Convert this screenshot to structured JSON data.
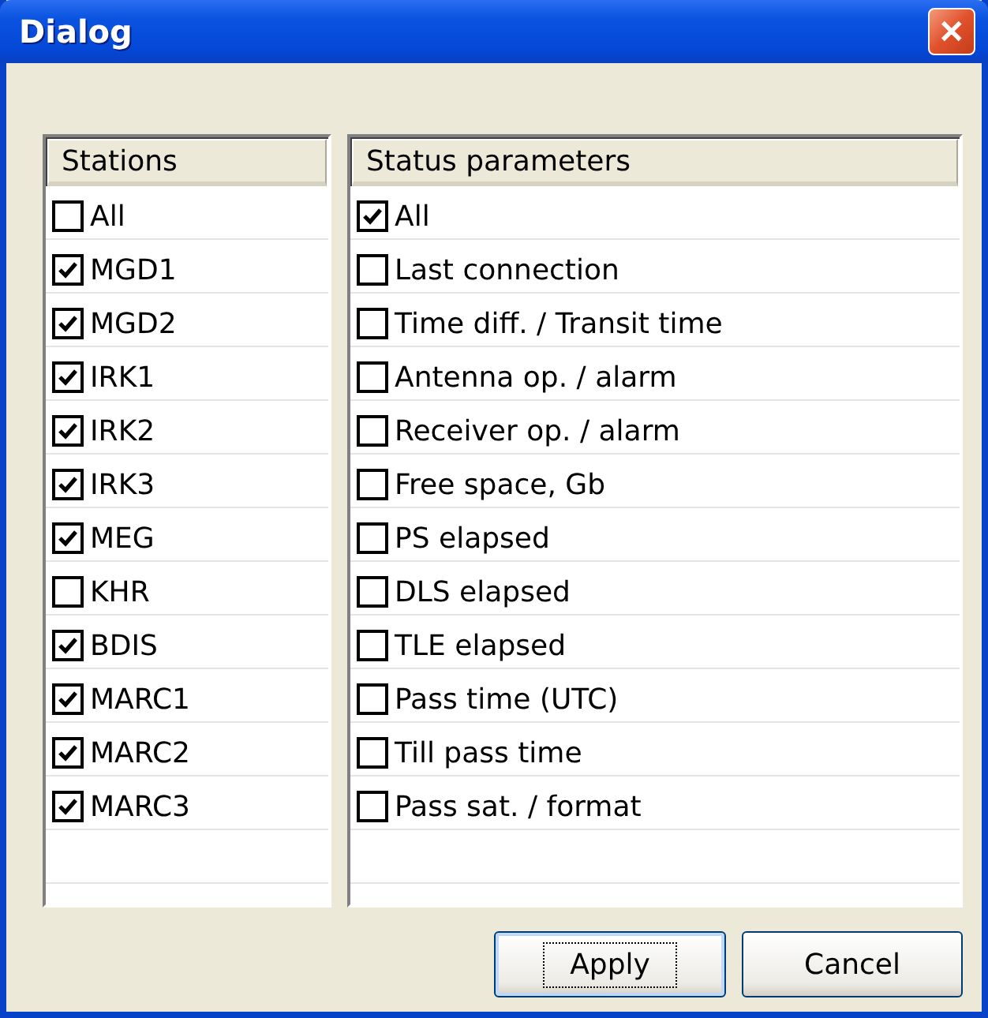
{
  "window": {
    "title": "Dialog",
    "close": "✕"
  },
  "stations": {
    "header": "Stations",
    "items": [
      {
        "label": "All",
        "checked": false
      },
      {
        "label": "MGD1",
        "checked": true
      },
      {
        "label": "MGD2",
        "checked": true
      },
      {
        "label": "IRK1",
        "checked": true
      },
      {
        "label": "IRK2",
        "checked": true
      },
      {
        "label": "IRK3",
        "checked": true
      },
      {
        "label": "MEG",
        "checked": true
      },
      {
        "label": "KHR",
        "checked": false
      },
      {
        "label": "BDIS",
        "checked": true
      },
      {
        "label": "MARC1",
        "checked": true
      },
      {
        "label": "MARC2",
        "checked": true
      },
      {
        "label": "MARC3",
        "checked": true
      }
    ]
  },
  "status_parameters": {
    "header": "Status parameters",
    "items": [
      {
        "label": "All",
        "checked": true
      },
      {
        "label": "Last connection",
        "checked": false
      },
      {
        "label": "Time diff. / Transit time",
        "checked": false
      },
      {
        "label": "Antenna op. / alarm",
        "checked": false
      },
      {
        "label": "Receiver op. / alarm",
        "checked": false
      },
      {
        "label": "Free space, Gb",
        "checked": false
      },
      {
        "label": "PS elapsed",
        "checked": false
      },
      {
        "label": "DLS elapsed",
        "checked": false
      },
      {
        "label": "TLE elapsed",
        "checked": false
      },
      {
        "label": "Pass time (UTC)",
        "checked": false
      },
      {
        "label": "Till pass time",
        "checked": false
      },
      {
        "label": "Pass sat. / format",
        "checked": false
      }
    ]
  },
  "buttons": [
    {
      "label": "Apply",
      "focused": true
    },
    {
      "label": "Cancel",
      "focused": false
    }
  ]
}
